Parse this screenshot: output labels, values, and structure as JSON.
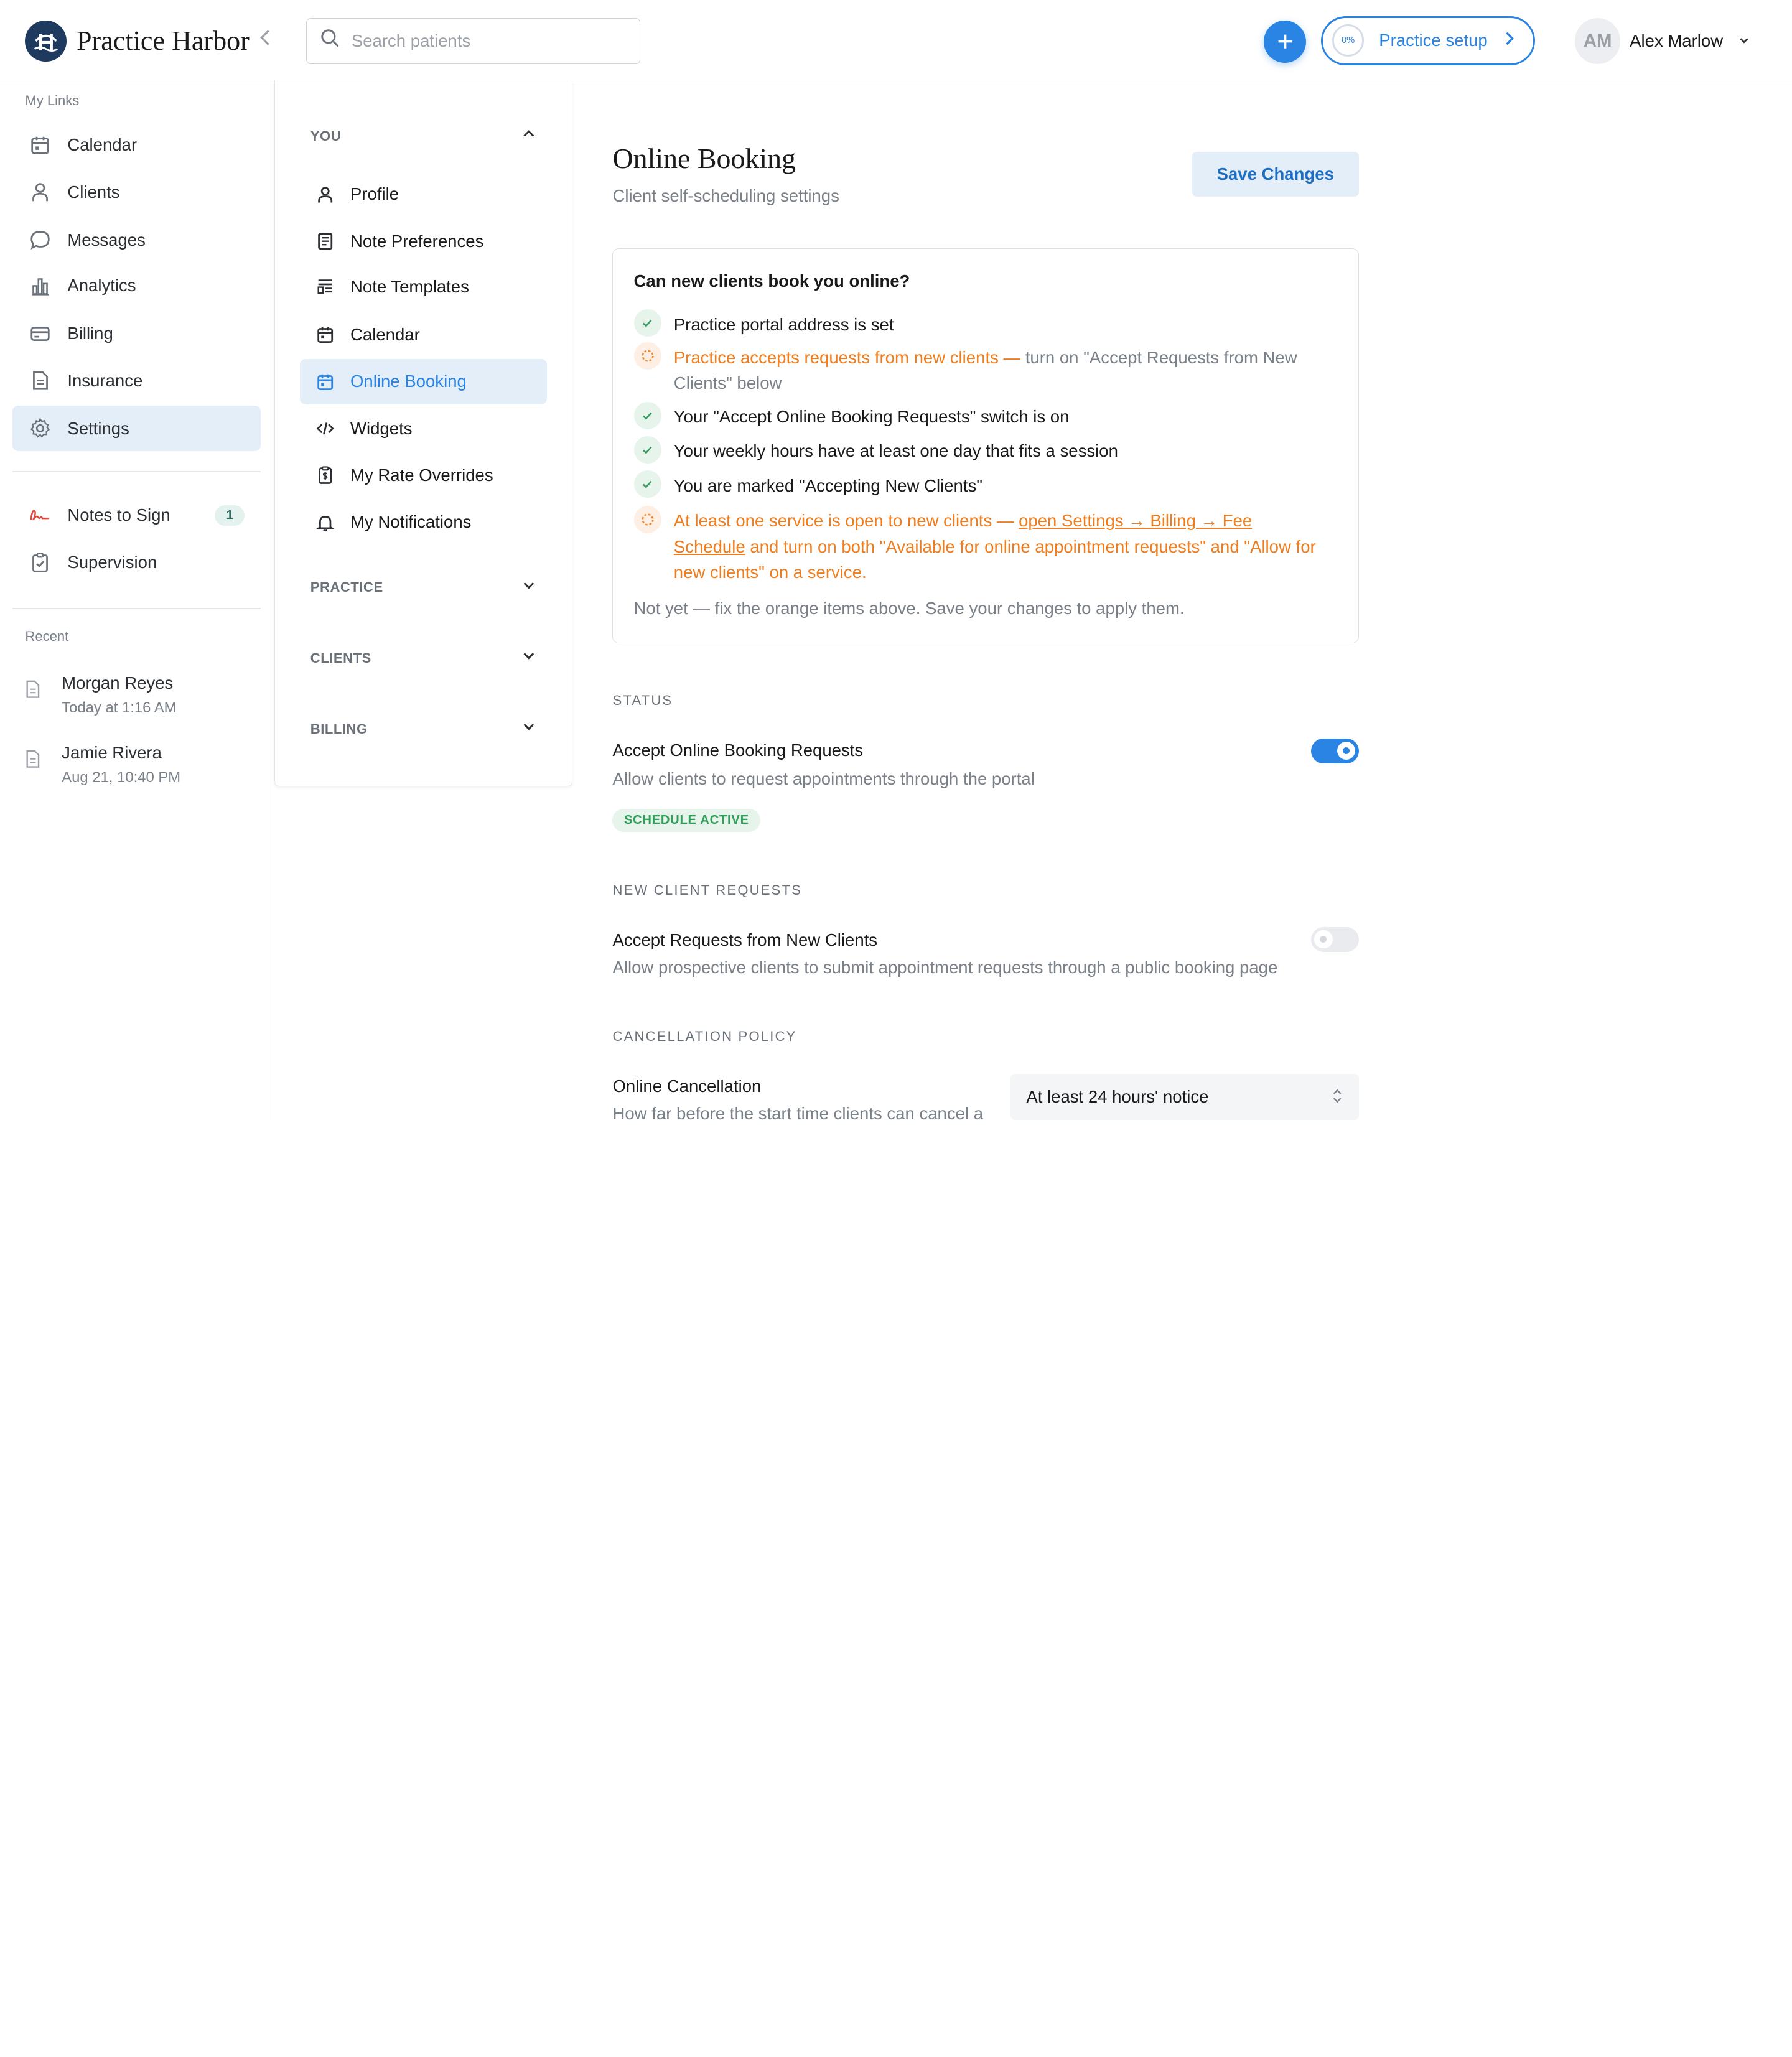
{
  "app": {
    "brand": "Practice Harbor"
  },
  "search": {
    "placeholder": "Search patients"
  },
  "topbar": {
    "setup_label": "Practice setup",
    "setup_progress": "0%",
    "user_initials": "AM",
    "user_name": "Alex Marlow"
  },
  "sidebar": {
    "my_links_label": "My Links",
    "items": [
      {
        "label": "Calendar",
        "icon": "calendar-icon"
      },
      {
        "label": "Clients",
        "icon": "person-icon"
      },
      {
        "label": "Messages",
        "icon": "chat-bubble-icon"
      },
      {
        "label": "Analytics",
        "icon": "bar-chart-icon"
      },
      {
        "label": "Billing",
        "icon": "card-icon"
      },
      {
        "label": "Insurance",
        "icon": "document-icon"
      },
      {
        "label": "Settings",
        "icon": "gear-icon",
        "active": true
      }
    ],
    "extra_items": [
      {
        "label": "Notes to Sign",
        "icon": "signature-icon",
        "badge": "1"
      },
      {
        "label": "Supervision",
        "icon": "clipboard-check-icon"
      }
    ],
    "recent_label": "Recent",
    "recent": [
      {
        "name": "Morgan Reyes",
        "time": "Today at 1:16 AM"
      },
      {
        "name": "Jamie Rivera",
        "time": "Aug 21, 10:40 PM"
      }
    ]
  },
  "settings_menu": {
    "sections": [
      {
        "label": "YOU",
        "expanded": true
      },
      {
        "label": "PRACTICE",
        "expanded": false
      },
      {
        "label": "CLIENTS",
        "expanded": false
      },
      {
        "label": "BILLING",
        "expanded": false
      }
    ],
    "you_items": [
      {
        "label": "Profile",
        "icon": "person-icon"
      },
      {
        "label": "Note Preferences",
        "icon": "note-icon"
      },
      {
        "label": "Note Templates",
        "icon": "template-icon"
      },
      {
        "label": "Calendar",
        "icon": "calendar-icon"
      },
      {
        "label": "Online Booking",
        "icon": "calendar-icon",
        "active": true
      },
      {
        "label": "Widgets",
        "icon": "code-icon"
      },
      {
        "label": "My Rate Overrides",
        "icon": "dollar-doc-icon"
      },
      {
        "label": "My Notifications",
        "icon": "bell-icon"
      }
    ]
  },
  "main": {
    "title": "Online Booking",
    "subtitle": "Client self-scheduling settings",
    "save_label": "Save Changes",
    "checklist": {
      "title": "Can new clients book you online?",
      "items": [
        {
          "status": "ok",
          "text": "Practice portal address is set"
        },
        {
          "status": "warn",
          "text": "Practice accepts requests from new clients — ",
          "muted": "turn on \"Accept Requests from New Clients\" below"
        },
        {
          "status": "ok",
          "text": "Your \"Accept Online Booking Requests\" switch is on"
        },
        {
          "status": "ok",
          "text": "Your weekly hours have at least one day that fits a session"
        },
        {
          "status": "ok",
          "text": "You are marked \"Accepting New Clients\""
        },
        {
          "status": "warn",
          "text": "At least one service is open to new clients — ",
          "link": "open Settings → Billing → Fee Schedule",
          "after": " and turn on both \"Available for online appointment requests\" and \"Allow for new clients\" on a service."
        }
      ],
      "footer": "Not yet — fix the orange items above. Save your changes to apply them."
    },
    "status": {
      "heading": "STATUS",
      "title": "Accept Online Booking Requests",
      "desc": "Allow clients to request appointments through the portal",
      "on": true,
      "pill": "SCHEDULE ACTIVE"
    },
    "new_clients": {
      "heading": "NEW CLIENT REQUESTS",
      "title": "Accept Requests from New Clients",
      "desc": "Allow prospective clients to submit appointment requests through a public booking page",
      "on": false
    },
    "cancellation": {
      "heading": "CANCELLATION POLICY",
      "title": "Online Cancellation",
      "desc": "How far before the start time clients can cancel a",
      "selected": "At least 24 hours' notice"
    }
  },
  "colors": {
    "accent": "#2a84e3",
    "warning": "#ef7d1e",
    "success": "#3a9e63"
  }
}
